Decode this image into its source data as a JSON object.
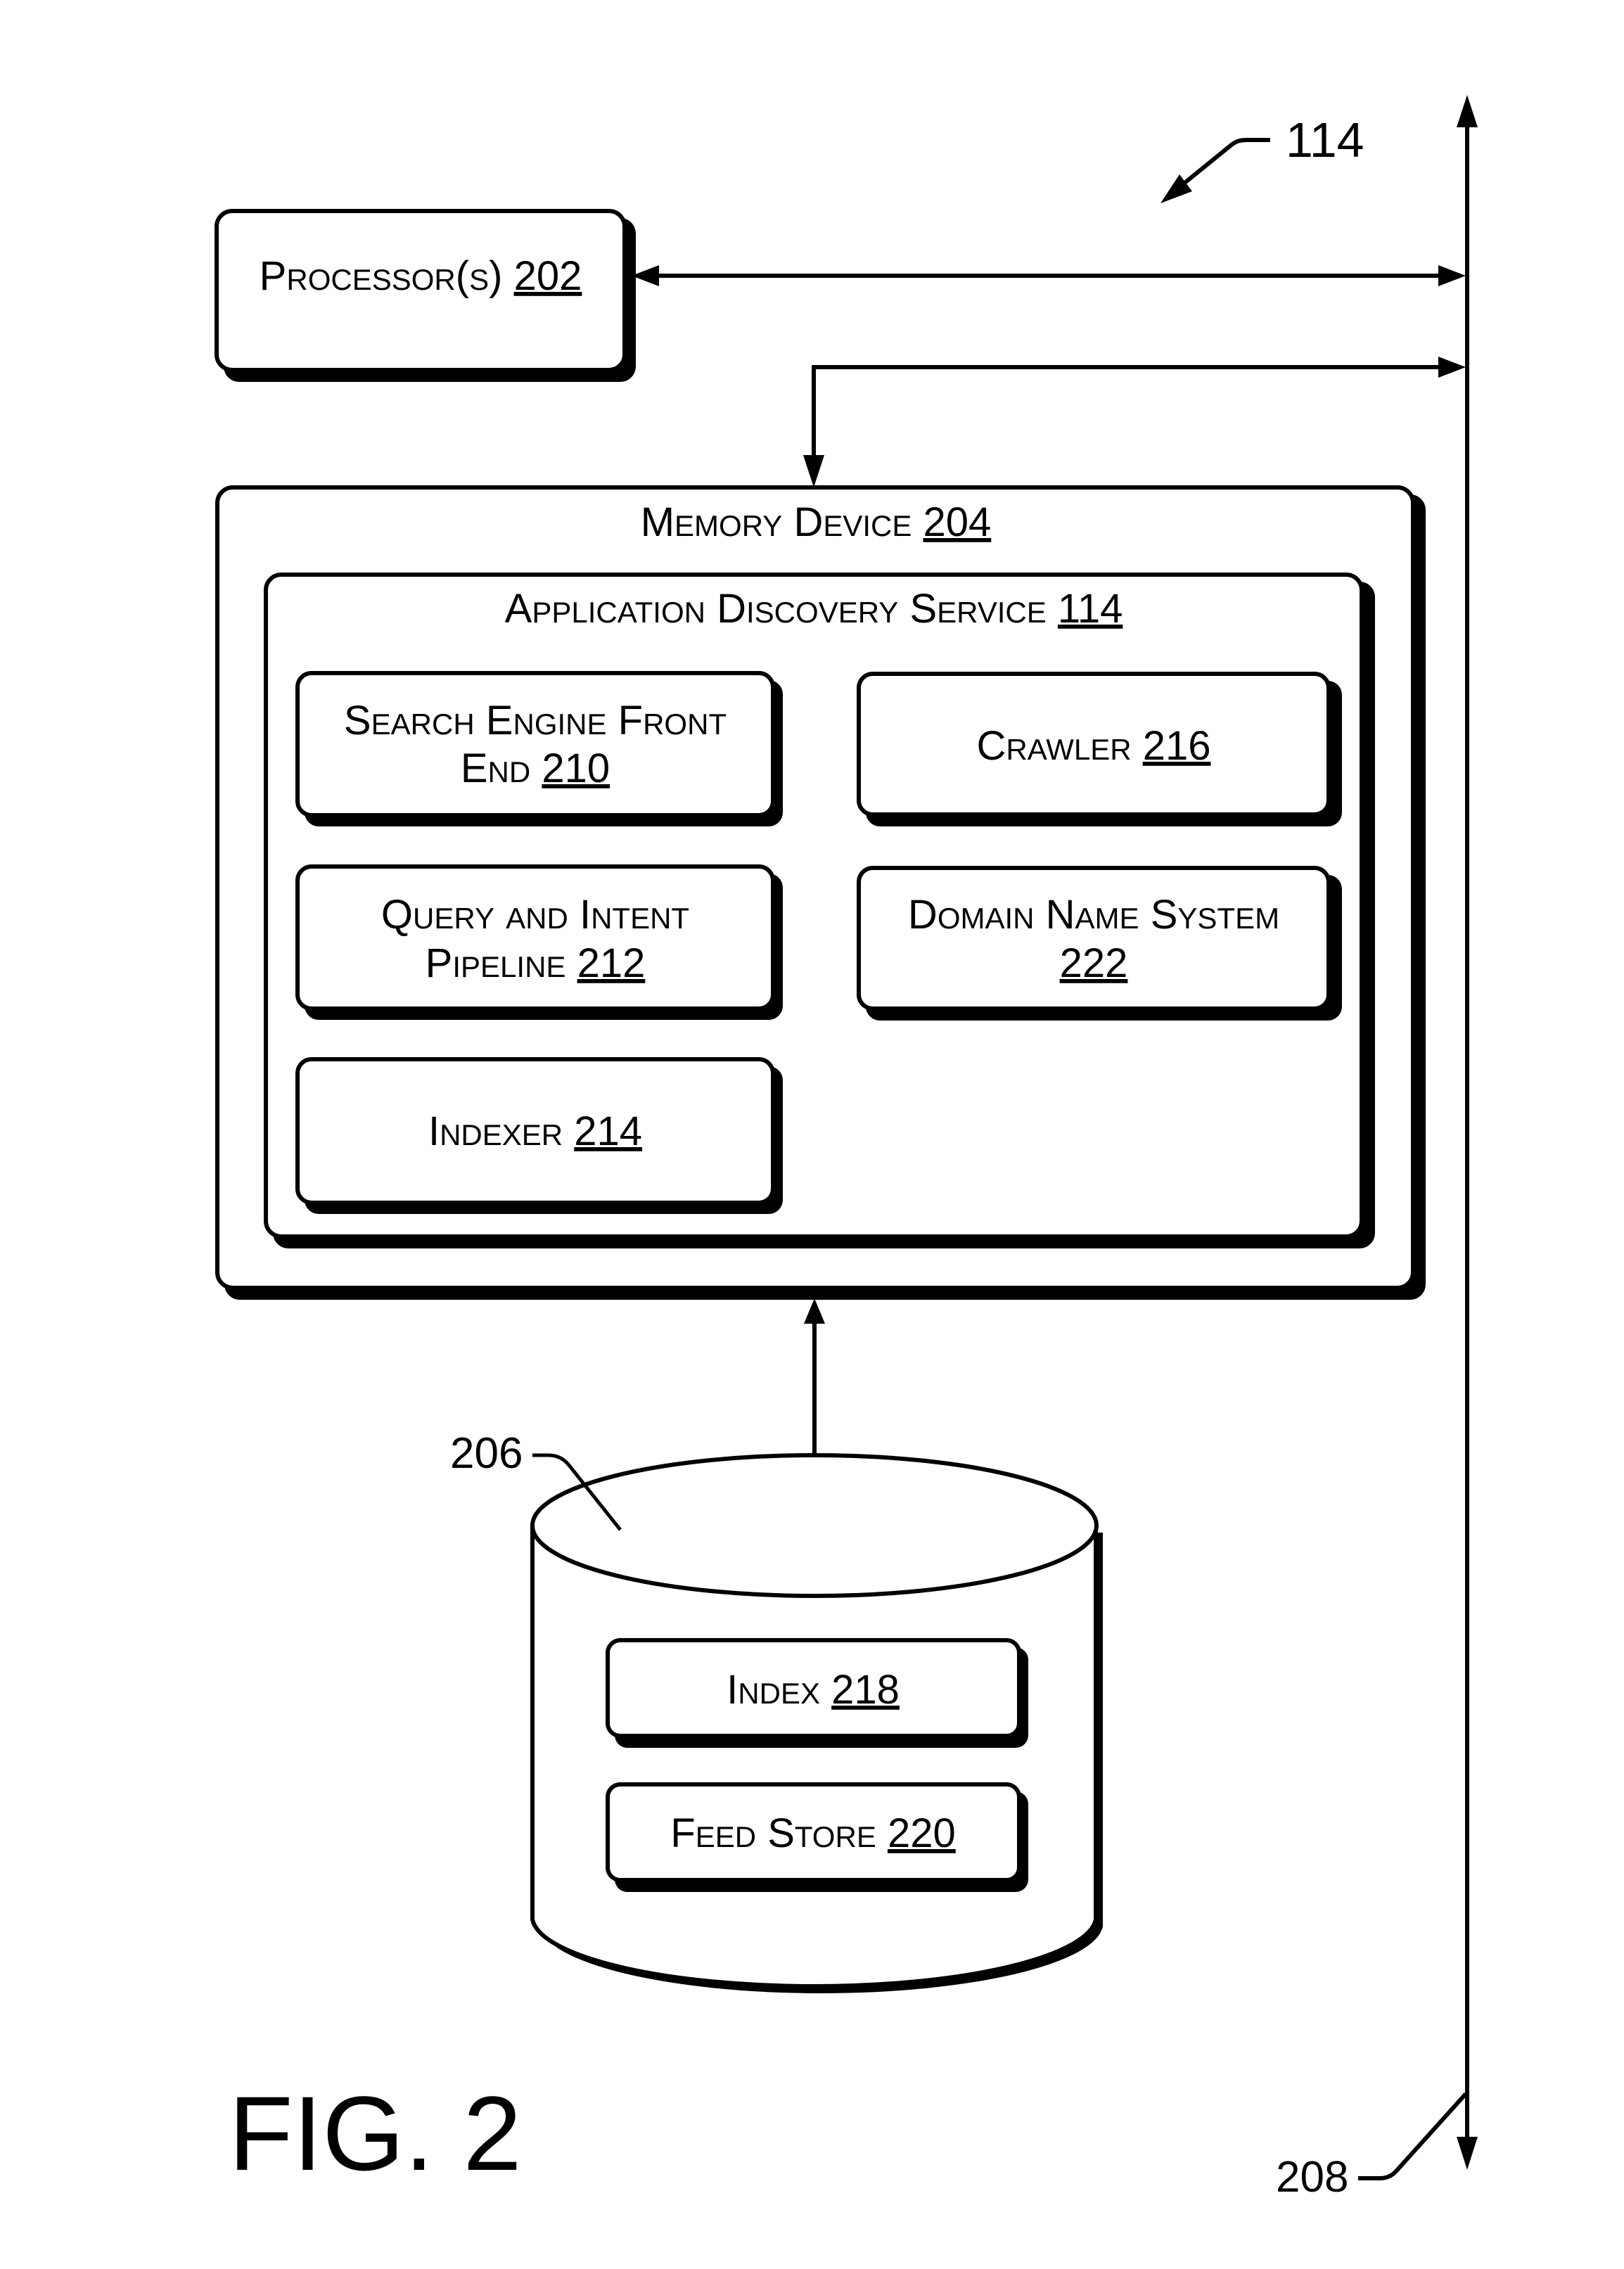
{
  "figure": {
    "label": "FIG. 2",
    "reference": "114",
    "colors": {
      "ink": "#000000",
      "paper": "#ffffff"
    }
  },
  "components": {
    "processor": {
      "name": "Processor(s)",
      "ref": "202"
    },
    "memory": {
      "name": "Memory Device",
      "ref": "204"
    },
    "app_service": {
      "name": "Application Discovery Service",
      "ref": "114"
    },
    "search_front_end": {
      "line1": "Search Engine Front",
      "line2": "End",
      "ref": "210"
    },
    "query_pipeline": {
      "line1": "Query and Intent",
      "line2": "Pipeline",
      "ref": "212"
    },
    "indexer": {
      "name": "Indexer",
      "ref": "214"
    },
    "crawler": {
      "name": "Crawler",
      "ref": "216"
    },
    "dns": {
      "line1": "Domain Name System",
      "line2": "",
      "ref": "222"
    },
    "storage": {
      "ref": "206"
    },
    "index": {
      "name": "Index",
      "ref": "218"
    },
    "feed_store": {
      "name": "Feed Store",
      "ref": "220"
    },
    "bus": {
      "ref": "208"
    }
  }
}
